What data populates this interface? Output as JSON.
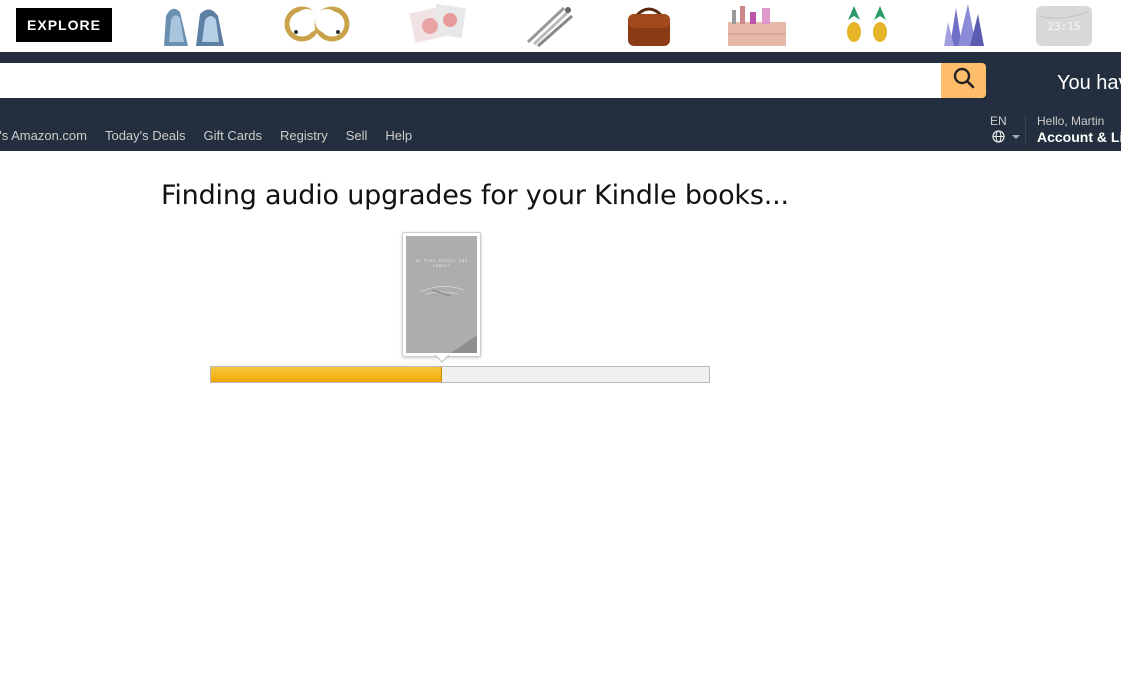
{
  "promo": {
    "explore_label": "EXPLORE",
    "products": [
      {
        "name": "geode-bookends-icon"
      },
      {
        "name": "moon-earrings-icon"
      },
      {
        "name": "pink-pins-icon"
      },
      {
        "name": "wind-chimes-icon"
      },
      {
        "name": "leather-bag-icon"
      },
      {
        "name": "makeup-organizer-icon"
      },
      {
        "name": "pineapple-earrings-icon"
      },
      {
        "name": "crystal-cluster-icon"
      },
      {
        "name": "marble-clock-icon"
      }
    ],
    "clock_text": "23:15"
  },
  "header": {
    "search_value": "",
    "search_placeholder": "",
    "you_have_text": "You hav"
  },
  "nav": {
    "links": [
      "n's Amazon.com",
      "Today's Deals",
      "Gift Cards",
      "Registry",
      "Sell",
      "Help"
    ],
    "language_code": "EN",
    "greeting": "Hello, Martin",
    "account_label": "Account & Li"
  },
  "main": {
    "title": "Finding audio upgrades for your Kindle books...",
    "book_cover_text": "as true stoals san reaner"
  },
  "progress": {
    "fraction": 0.464
  },
  "colors": {
    "nav_bg": "#232f3e",
    "search_button": "#febd69",
    "progress_fill": "#f0a800"
  }
}
